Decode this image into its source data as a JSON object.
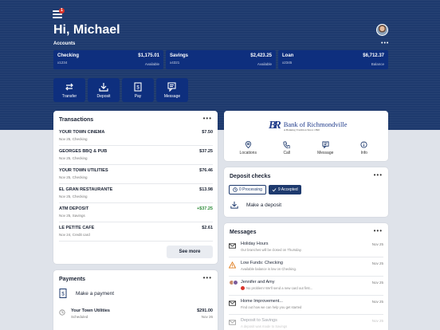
{
  "header": {
    "greeting": "Hi, Michael",
    "accounts_label": "Accounts",
    "menu_badge": "1",
    "more": "•••"
  },
  "accounts": [
    {
      "name": "Checking",
      "number": "x1234",
      "amount": "$1,175.01",
      "sub": "Available"
    },
    {
      "name": "Savings",
      "number": "x4321",
      "amount": "$2,423.25",
      "sub": "Available"
    },
    {
      "name": "Loan",
      "number": "x2345",
      "amount": "$6,712.37",
      "sub": "Balance"
    }
  ],
  "actions": [
    {
      "label": "Transfer",
      "icon": "transfer-icon"
    },
    {
      "label": "Deposit",
      "icon": "deposit-icon"
    },
    {
      "label": "Pay",
      "icon": "pay-icon"
    },
    {
      "label": "Message",
      "icon": "message-icon"
    }
  ],
  "transactions": {
    "title": "Transactions",
    "more": "•••",
    "items": [
      {
        "name": "YOUR TOWN CINEMA",
        "date": "Nov 25, Checking",
        "amount": "$7.50",
        "credit": false
      },
      {
        "name": "GEORGES BBQ & PUB",
        "date": "Nov 25, Checking",
        "amount": "$37.25",
        "credit": false
      },
      {
        "name": "YOUR TOWN UTILITIES",
        "date": "Nov 25, Checking",
        "amount": "$76.46",
        "credit": false
      },
      {
        "name": "EL GRAN RESTAURANTE",
        "date": "Nov 25, Checking",
        "amount": "$13.98",
        "credit": false
      },
      {
        "name": "ATM DEPOSIT",
        "date": "Nov 25, Savings",
        "amount": "+$37.25",
        "credit": true
      },
      {
        "name": "LE PETITE CAFE",
        "date": "Nov 24, Credit card",
        "amount": "$2.61",
        "credit": false
      }
    ],
    "see_more": "See more"
  },
  "payments": {
    "title": "Payments",
    "more": "•••",
    "make_payment": "Make a payment",
    "bill": {
      "name": "Your Town Utilities",
      "sub": "Scheduled",
      "amount": "$291.00",
      "date": "Nov 26"
    }
  },
  "bank": {
    "mark": "BR",
    "name": "Bank of Richmondville",
    "tagline": "A Banking Tradition Since 1890",
    "actions": [
      {
        "label": "Locations",
        "icon": "location-pin-icon"
      },
      {
        "label": "Call",
        "icon": "phone-icon"
      },
      {
        "label": "Message",
        "icon": "message-icon"
      },
      {
        "label": "Info",
        "icon": "info-icon"
      }
    ]
  },
  "deposit": {
    "title": "Deposit checks",
    "more": "•••",
    "processing": "0 Processing",
    "accepted": "9 Accepted",
    "make_deposit": "Make a deposit"
  },
  "messages": {
    "title": "Messages",
    "more": "•••",
    "items": [
      {
        "title": "Holiday Hours",
        "body": "Our branches will be closed on Thursday.",
        "date": "Nov 25",
        "icon": "envelope-icon"
      },
      {
        "title": "Low Funds: Checking",
        "body": "Available balance is low on Checking.",
        "date": "Nov 25",
        "icon": "warning-icon"
      },
      {
        "title": "Jennifer and Amy",
        "body": "No problem! We'll send a new card out first...",
        "date": "Nov 25",
        "icon": "people-avatars"
      },
      {
        "title": "Home Improvement...",
        "body": "Find out how we can help you get started",
        "date": "Nov 25",
        "icon": "envelope-icon"
      },
      {
        "title": "Deposit to Savings",
        "body": "A deposit was made to Savings",
        "date": "Nov 25",
        "icon": "envelope-icon"
      }
    ]
  },
  "colors": {
    "hero": "#1e3a6e",
    "account_tile": "#0e2f7e",
    "credit_green": "#2e8b3a",
    "warning_orange": "#e07b1a",
    "badge_red": "#d9342b"
  }
}
